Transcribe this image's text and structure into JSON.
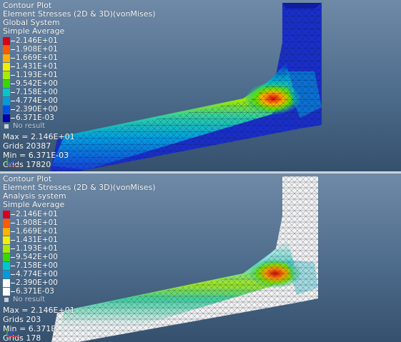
{
  "colors": {
    "scale": [
      "#d8001a",
      "#ff5a00",
      "#ffb000",
      "#f2f000",
      "#a6ec00",
      "#3ad700",
      "#00cc70",
      "#00c8c8",
      "#009ce0",
      "#0050e0",
      "#0000a8"
    ],
    "no_result": "#c7cfd8"
  },
  "top": {
    "title": "Contour Plot",
    "subtitle": "Element Stresses (2D & 3D)(vonMises)",
    "system": "Global System",
    "averaging": "Simple Average",
    "scale_labels": [
      "2.146E+01",
      "1.908E+01",
      "1.669E+01",
      "1.431E+01",
      "1.193E+01",
      "9.542E+00",
      "7.158E+00",
      "4.774E+00",
      "2.390E+00",
      "6.371E-03"
    ],
    "no_result": "No result",
    "max": "Max = 2.146E+01",
    "grids": "Grids 20387",
    "min": "Min = 6.371E-03",
    "grids2": "Grids 17820"
  },
  "bottom": {
    "title": "Contour Plot",
    "subtitle": "Element Stresses (2D & 3D)(vonMises)",
    "system": "Analysis system",
    "averaging": "Simple Average",
    "scale_labels": [
      "2.146E+01",
      "1.908E+01",
      "1.669E+01",
      "1.431E+01",
      "1.193E+01",
      "9.542E+00",
      "7.158E+00",
      "4.774E+00",
      "2.390E+00",
      "6.371E-03"
    ],
    "no_result": "No result",
    "max": "Max = 2.146E+01",
    "grids": "Grids 203",
    "min": "Min = 6.371E",
    "grids2": "Grids 178"
  }
}
